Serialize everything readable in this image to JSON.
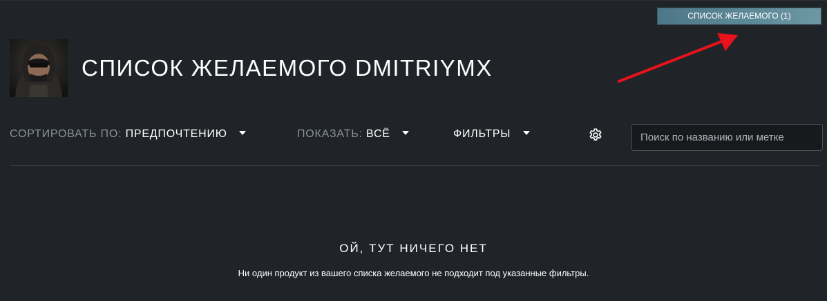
{
  "header": {
    "wishlist_button_label": "СПИСОК ЖЕЛАЕМОГО (1)",
    "title": "СПИСОК ЖЕЛАЕМОГО DMITRIYMX"
  },
  "controls": {
    "sort_label": "СОРТИРОВАТЬ ПО:",
    "sort_value": "ПРЕДПОЧТЕНИЮ",
    "show_label": "ПОКАЗАТЬ:",
    "show_value": "ВСЁ",
    "filters_label": "ФИЛЬТРЫ",
    "settings_icon": "gear-icon",
    "search_placeholder": "Поиск по названию или метке"
  },
  "empty_state": {
    "title": "ОЙ, ТУТ НИЧЕГО НЕТ",
    "description": "Ни один продукт из вашего списка желаемого не подходит под указанные фильтры."
  },
  "colors": {
    "background": "#202429",
    "wishlist_button": "#5e8a98",
    "annotation_arrow": "#e8121a",
    "muted_label": "#8b929a"
  }
}
